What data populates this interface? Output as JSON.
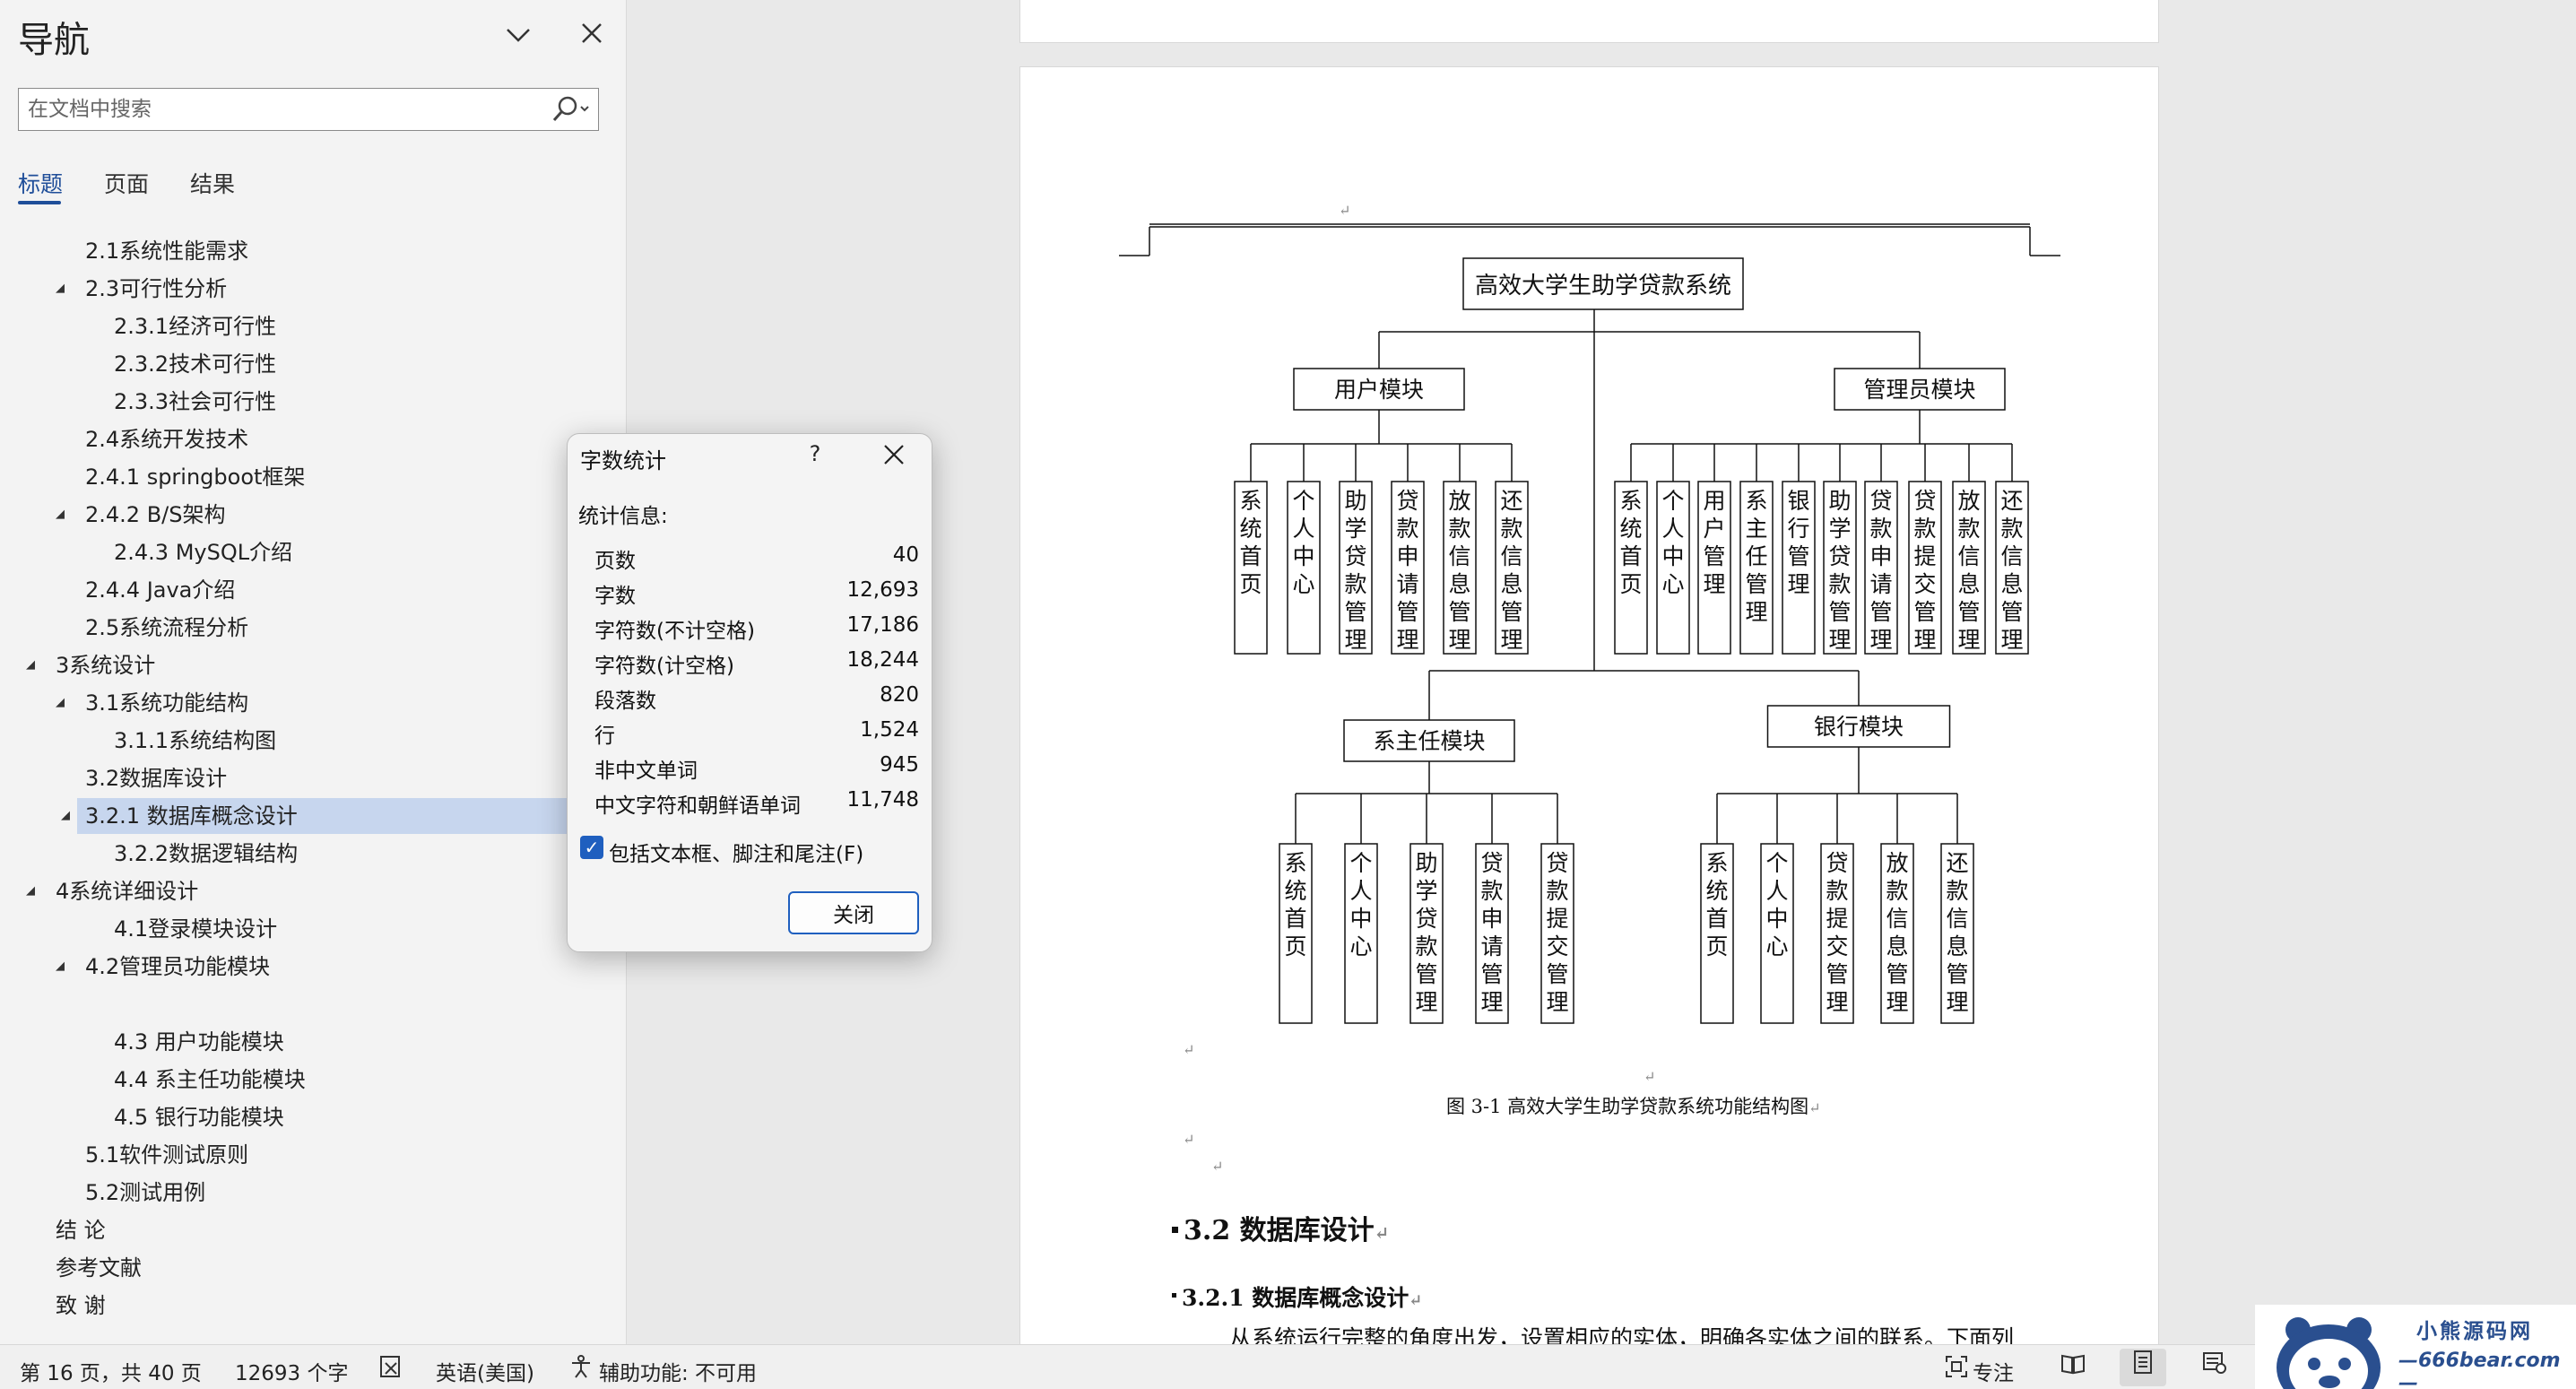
{
  "navigation": {
    "title": "导航",
    "search_placeholder": "在文档中搜索",
    "tabs": [
      "标题",
      "页面",
      "结果"
    ],
    "active_tab": "标题",
    "headings": [
      {
        "text": "2.1系统性能需求",
        "level": 2,
        "expander": ""
      },
      {
        "text": "2.3可行性分析",
        "level": 2,
        "expander": "◢"
      },
      {
        "text": "2.3.1经济可行性",
        "level": 3,
        "expander": ""
      },
      {
        "text": "2.3.2技术可行性",
        "level": 3,
        "expander": ""
      },
      {
        "text": "2.3.3社会可行性",
        "level": 3,
        "expander": ""
      },
      {
        "text": "2.4系统开发技术",
        "level": 2,
        "expander": ""
      },
      {
        "text": "2.4.1 springboot框架",
        "level": 2,
        "expander": ""
      },
      {
        "text": "2.4.2 B/S架构",
        "level": 2,
        "expander": "◢"
      },
      {
        "text": "2.4.3 MySQL介绍",
        "level": 3,
        "expander": ""
      },
      {
        "text": "2.4.4 Java介绍",
        "level": 2,
        "expander": ""
      },
      {
        "text": "2.5系统流程分析",
        "level": 2,
        "expander": ""
      },
      {
        "text": "3系统设计",
        "level": 1,
        "expander": "◢"
      },
      {
        "text": "3.1系统功能结构",
        "level": 2,
        "expander": "◢"
      },
      {
        "text": "3.1.1系统结构图",
        "level": 3,
        "expander": ""
      },
      {
        "text": "3.2数据库设计",
        "level": 2,
        "expander": ""
      },
      {
        "text": "3.2.1 数据库概念设计",
        "level": 2,
        "expander": "◢",
        "selected": true
      },
      {
        "text": "3.2.2数据逻辑结构",
        "level": 3,
        "expander": ""
      },
      {
        "text": "4系统详细设计",
        "level": 1,
        "expander": "◢"
      },
      {
        "text": "4.1登录模块设计",
        "level": 3,
        "expander": ""
      },
      {
        "text": "4.2管理员功能模块",
        "level": 2,
        "expander": "◢"
      },
      {
        "text": "",
        "level": 3,
        "expander": ""
      },
      {
        "text": "4.3 用户功能模块",
        "level": 3,
        "expander": ""
      },
      {
        "text": "4.4 系主任功能模块",
        "level": 3,
        "expander": ""
      },
      {
        "text": "4.5 银行功能模块",
        "level": 3,
        "expander": ""
      },
      {
        "text": "5.1软件测试原则",
        "level": 2,
        "expander": ""
      },
      {
        "text": "5.2测试用例",
        "level": 2,
        "expander": ""
      },
      {
        "text": "结  论",
        "level": 1,
        "expander": ""
      },
      {
        "text": "参考文献",
        "level": 1,
        "expander": ""
      },
      {
        "text": "致  谢",
        "level": 1,
        "expander": ""
      }
    ]
  },
  "word_count_dialog": {
    "title": "字数统计",
    "help": "?",
    "subtitle": "统计信息:",
    "stats": [
      {
        "label": "页数",
        "value": "40"
      },
      {
        "label": "字数",
        "value": "12,693"
      },
      {
        "label": "字符数(不计空格)",
        "value": "17,186"
      },
      {
        "label": "字符数(计空格)",
        "value": "18,244"
      },
      {
        "label": "段落数",
        "value": "820"
      },
      {
        "label": "行",
        "value": "1,524"
      },
      {
        "label": "非中文单词",
        "value": "945"
      },
      {
        "label": "中文字符和朝鲜语单词",
        "value": "11,748"
      }
    ],
    "checkbox_label": "包括文本框、脚注和尾注(F)",
    "checkbox_checked": true,
    "close_button": "关闭"
  },
  "document": {
    "figure": {
      "root": "高效大学生助学贷款系统",
      "modules": [
        {
          "name": "用户模块",
          "items": [
            "系统首页",
            "个人中心",
            "助学贷款管理",
            "贷款申请管理",
            "放款信息管理",
            "还款信息管理"
          ]
        },
        {
          "name": "管理员模块",
          "items": [
            "系统首页",
            "个人中心",
            "用户管理",
            "系主任管理",
            "银行管理",
            "助学贷款管理",
            "贷款申请管理",
            "贷款提交管理",
            "放款信息管理",
            "还款信息管理"
          ]
        },
        {
          "name": "系主任模块",
          "items": [
            "系统首页",
            "个人中心",
            "助学贷款管理",
            "贷款申请管理",
            "贷款提交管理"
          ]
        },
        {
          "name": "银行模块",
          "items": [
            "系统首页",
            "个人中心",
            "贷款提交管理",
            "放款信息管理",
            "还款信息管理"
          ]
        }
      ],
      "caption": "图 3-1  高效大学生助学贷款系统功能结构图"
    },
    "return_mark": "↵",
    "heading_2": "3.2 数据库设计",
    "heading_3": "3.2.1  数据库概念设计",
    "body_text": "从系统运行完整的角度出发，设置相应的实体，明确各实体之间的联系。下面列"
  },
  "status_bar": {
    "page": "第 16 页，共 40 页",
    "words": "12693 个字",
    "language": "英语(美国)",
    "accessibility": "辅助功能: 不可用",
    "focus": "专注"
  },
  "watermark": {
    "name": "小熊源码网",
    "url": "—666bear.com—"
  }
}
